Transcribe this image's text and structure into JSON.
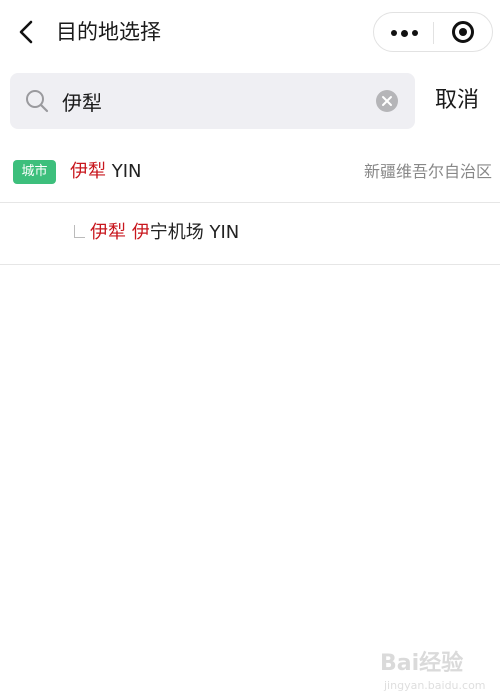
{
  "header": {
    "title": "目的地选择"
  },
  "search": {
    "value": "伊犁",
    "cancel_label": "取消"
  },
  "results": {
    "city": {
      "badge": "城市",
      "name_highlight": "伊犁",
      "name_rest": " YIN",
      "region": "新疆维吾尔自治区"
    },
    "airport": {
      "highlight_1": "伊犁",
      "gap": " ",
      "highlight_2": "伊",
      "name_rest": "宁机场 YIN"
    }
  },
  "watermark": {
    "brand": "Bai",
    "brand_cn": "经验",
    "url": "jingyan.baidu.com"
  },
  "colors": {
    "highlight": "#c8161d",
    "badge_green": "#3dbf7c",
    "search_bg": "#efeff3"
  },
  "icons": [
    "back-arrow-icon",
    "more-dots-icon",
    "mini-program-close-icon",
    "search-icon",
    "clear-icon"
  ]
}
